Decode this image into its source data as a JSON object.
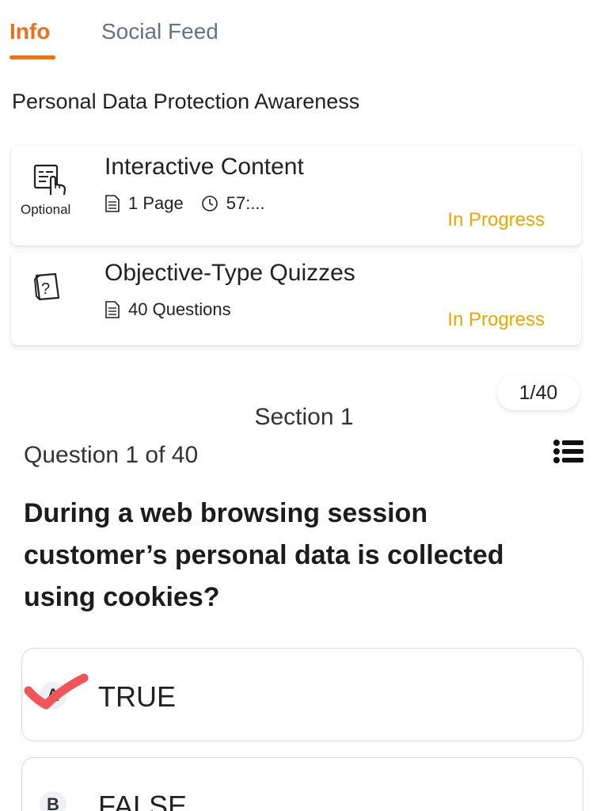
{
  "tabs": {
    "info": "Info",
    "social_feed": "Social Feed"
  },
  "course": {
    "title": "Personal Data Protection Awareness"
  },
  "cards": [
    {
      "icon": "touch-content-icon",
      "badge": "Optional",
      "title": "Interactive Content",
      "meta1": "1 Page",
      "meta2": "57:...",
      "status": "In Progress"
    },
    {
      "icon": "quiz-question-icon",
      "title": "Objective-Type Quizzes",
      "meta1": "40 Questions",
      "status": "In Progress"
    }
  ],
  "quiz": {
    "counter": "1/40",
    "section": "Section 1",
    "question_number": "Question 1 of 40",
    "question_text": "During a web browsing session customer’s personal data is collected using cookies?",
    "options": [
      {
        "letter": "A",
        "text": "TRUE"
      },
      {
        "letter": "B",
        "text": "FALSE"
      }
    ]
  },
  "colors": {
    "accent": "#e8711e",
    "status": "#e6a800",
    "check_mark": "#f0555a"
  }
}
